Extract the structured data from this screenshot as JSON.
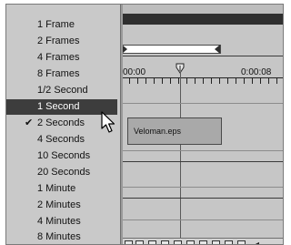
{
  "menu": {
    "items": [
      {
        "label": "1 Frame"
      },
      {
        "label": "2 Frames"
      },
      {
        "label": "4 Frames"
      },
      {
        "label": "8 Frames"
      },
      {
        "label": "1/2 Second"
      },
      {
        "label": "1 Second"
      },
      {
        "label": "2 Seconds"
      },
      {
        "label": "4 Seconds"
      },
      {
        "label": "10 Seconds"
      },
      {
        "label": "20 Seconds"
      },
      {
        "label": "1 Minute"
      },
      {
        "label": "2 Minutes"
      },
      {
        "label": "4 Minutes"
      },
      {
        "label": "8 Minutes"
      }
    ],
    "highlighted_item": "1 Second",
    "checked_item": "2 Seconds"
  },
  "timeline": {
    "time_start": "00:00",
    "time_end": "0:00:08",
    "clip_label": "Veloman.eps"
  },
  "colors": {
    "menu_background": "#c9c9c9",
    "highlight": "#3d3d3d",
    "timeline_background": "#c6c6c6",
    "title_bar": "#2f2f2f"
  },
  "icons": [
    "check-icon",
    "mouse-cursor-icon",
    "current-time-marker-icon"
  ]
}
